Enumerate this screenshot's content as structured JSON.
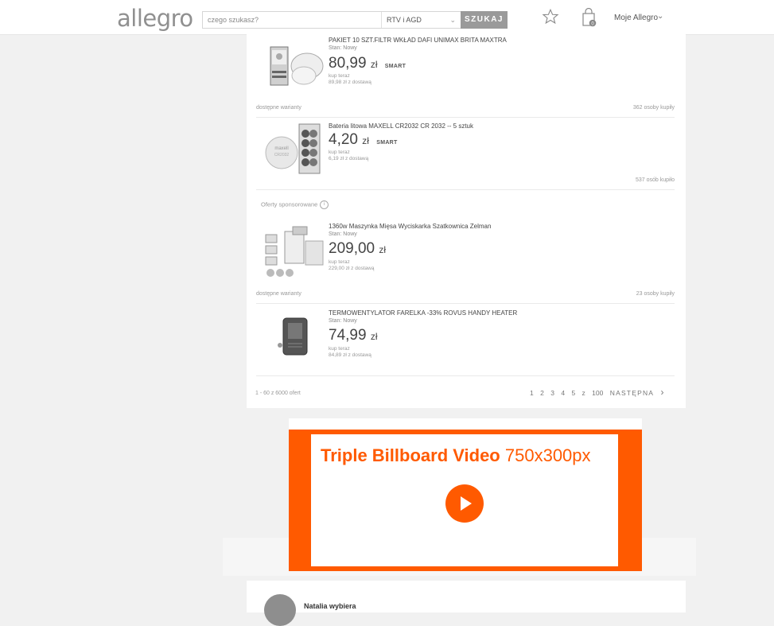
{
  "header": {
    "logo": "allegro",
    "search_placeholder": "czego szukasz?",
    "category": "RTV i AGD",
    "search_button": "SZUKAJ",
    "account_label": "Moje Allegro"
  },
  "listings": [
    {
      "title": "PAKIET 10 SZT.FILTR WKŁAD DAFI UNIMAX BRITA MAXTRA",
      "condition": "Stan: Nowy",
      "price_main": "80,99",
      "price_currency": "zł",
      "smart": "SMART",
      "buy_now": "kup teraz",
      "shipping": "89,98 zł z dostawą",
      "variants": "dostępne warianty",
      "buyers": "362 osoby kupiły"
    },
    {
      "title": "Bateria litowa MAXELL CR2032 CR 2032 -- 5 sztuk",
      "condition": "",
      "price_main": "4,20",
      "price_currency": "zł",
      "smart": "SMART",
      "buy_now": "kup teraz",
      "shipping": "6,19 zł z dostawą",
      "variants": "",
      "buyers": "537 osób kupiło"
    }
  ],
  "sponsored_label": "Oferty sponsorowane",
  "sponsored": [
    {
      "title": "1360w Maszynka Mięsa Wyciskarka Szatkownica Zelman",
      "condition": "Stan: Nowy",
      "price_main": "209,00",
      "price_currency": "zł",
      "buy_now": "kup teraz",
      "shipping": "229,00 zł z dostawą",
      "variants": "dostępne warianty",
      "buyers": "23 osoby kupiły"
    },
    {
      "title": "TERMOWENTYLATOR FARELKA -33% ROVUS HANDY HEATER",
      "condition": "Stan: Nowy",
      "price_main": "74,99",
      "price_currency": "zł",
      "buy_now": "kup teraz",
      "shipping": "84,89 zł z dostawą"
    }
  ],
  "footer": {
    "offers_count": "1 - 60 z 6000 ofert",
    "pages": [
      "1",
      "2",
      "3",
      "4",
      "5"
    ],
    "of": "z",
    "last_page": "100",
    "next": "NASTĘPNA"
  },
  "ad": {
    "title_bold": "Triple Billboard Video",
    "title_size": "750x300px"
  },
  "bottom": {
    "text": "Natalia wybiera"
  },
  "colors": {
    "brand_orange": "#ff5a00",
    "button_grey": "#9a9a9a",
    "page_bg": "#f1f1f1"
  }
}
